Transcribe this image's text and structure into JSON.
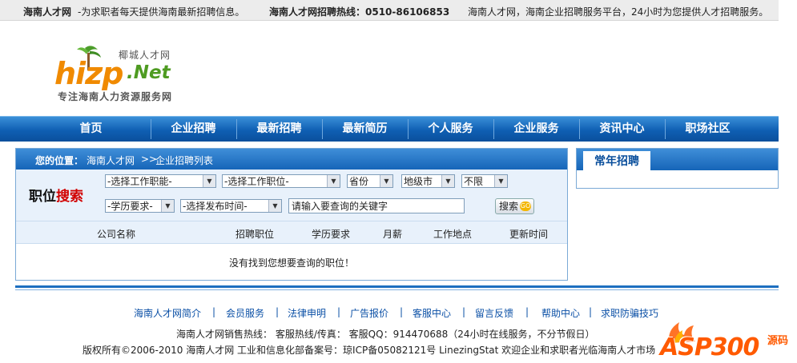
{
  "topbar": {
    "site_name": "海南人才网",
    "site_tagline": "-为求职者每天提供海南最新招聘信息。",
    "hotline_label": "海南人才网招聘热线：0510-86106853",
    "slogan": "海南人才网，海南企业招聘服务平台，24小时为您提供人才招聘服务。"
  },
  "logo": {
    "main": "hizp",
    "suffix": ".Net",
    "cn_name": "椰城人才网",
    "tagline": "专注海南人力资源服务网"
  },
  "nav": {
    "items": [
      "首页",
      "企业招聘",
      "最新招聘",
      "最新简历",
      "个人服务",
      "企业服务",
      "资讯中心",
      "职场社区"
    ]
  },
  "crumb": {
    "label": "您的位置：",
    "home": "海南人才网",
    "sep": ">>",
    "current": "企业招聘列表"
  },
  "search": {
    "title_a": "职位",
    "title_b": "搜索",
    "job_function": "-选择工作职能-",
    "job_position": "-选择工作职位-",
    "province": "省份",
    "city": "地级市",
    "district": "不限",
    "education": "-学历要求-",
    "publish_time": "-选择发布时间-",
    "keyword_value": "请输入要查询的关键字",
    "button_label": "搜索",
    "button_go": "GO"
  },
  "table": {
    "headers": [
      "公司名称",
      "招聘职位",
      "学历要求",
      "月薪",
      "工作地点",
      "更新时间"
    ],
    "empty_message": "没有找到您想要查询的职位！"
  },
  "side": {
    "tab_label": "常年招聘"
  },
  "footer": {
    "links": [
      "海南人才网简介",
      "会员服务",
      "法律申明",
      "广告报价",
      "客服中心",
      "留言反馈",
      "帮助中心",
      "求职防骗技巧"
    ],
    "link_sep": "|",
    "hotline": "海南人才网销售热线：    客服热线/传真：    客服QQ：914470688（24小时在线服务，不分节假日）",
    "copyright": "版权所有©2006-2010 海南人才网   工业和信息化部备案号：琼ICP备05082121号   LinezingStat   欢迎企业和求职者光临海南人才市场"
  },
  "watermark": {
    "text": "ASP300",
    "suffix": "源码"
  }
}
